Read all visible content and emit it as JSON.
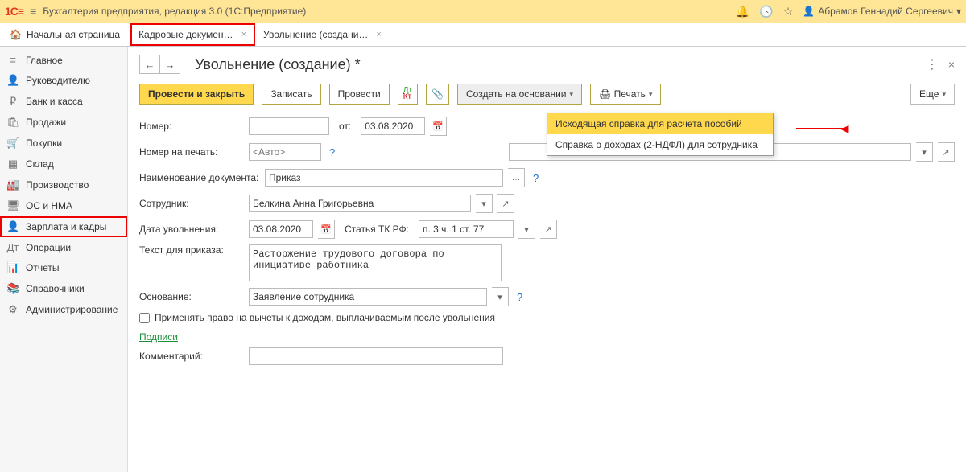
{
  "top": {
    "logo": "1C",
    "title": "Бухгалтерия предприятия, редакция 3.0   (1С:Предприятие)",
    "user": "Абрамов Геннадий Сергеевич"
  },
  "tabs": {
    "home": "Начальная страница",
    "t1": "Кадровые докумен…",
    "t2": "Увольнение (создани…"
  },
  "sidebar": {
    "items": [
      {
        "icon": "≡",
        "label": "Главное"
      },
      {
        "icon": "👤",
        "label": "Руководителю"
      },
      {
        "icon": "₽",
        "label": "Банк и касса"
      },
      {
        "icon": "🛍",
        "label": "Продажи"
      },
      {
        "icon": "🛒",
        "label": "Покупки"
      },
      {
        "icon": "▦",
        "label": "Склад"
      },
      {
        "icon": "🏭",
        "label": "Производство"
      },
      {
        "icon": "🖥",
        "label": "ОС и НМА"
      },
      {
        "icon": "👤",
        "label": "Зарплата и кадры"
      },
      {
        "icon": "Дт",
        "label": "Операции"
      },
      {
        "icon": "📊",
        "label": "Отчеты"
      },
      {
        "icon": "📚",
        "label": "Справочники"
      },
      {
        "icon": "⚙",
        "label": "Администрирование"
      }
    ]
  },
  "page": {
    "title": "Увольнение (создание) *"
  },
  "toolbar": {
    "post_close": "Провести и закрыть",
    "save": "Записать",
    "post": "Провести",
    "create_based": "Создать на основании",
    "print": "Печать",
    "more": "Еще"
  },
  "dropdown": {
    "item1": "Исходящая справка для расчета пособий",
    "item2": "Справка о доходах (2-НДФЛ) для сотрудника"
  },
  "form": {
    "number_lbl": "Номер:",
    "number": "",
    "from_lbl": "от:",
    "from": "03.08.2020",
    "print_number_lbl": "Номер на печать:",
    "print_number_ph": "<Авто>",
    "doc_name_lbl": "Наименование документа:",
    "doc_name": "Приказ",
    "employee_lbl": "Сотрудник:",
    "employee": "Белкина Анна Григорьевна",
    "fire_date_lbl": "Дата увольнения:",
    "fire_date": "03.08.2020",
    "tk_lbl": "Статья ТК РФ:",
    "tk": "п. 3 ч. 1 ст. 77",
    "order_text_lbl": "Текст для приказа:",
    "order_text": "Расторжение трудового договора по инициативе работника",
    "basis_lbl": "Основание:",
    "basis": "Заявление сотрудника",
    "deduction_chk": "Применять право на вычеты к доходам, выплачиваемым после увольнения",
    "signatures": "Подписи",
    "comment_lbl": "Комментарий:",
    "comment": ""
  }
}
